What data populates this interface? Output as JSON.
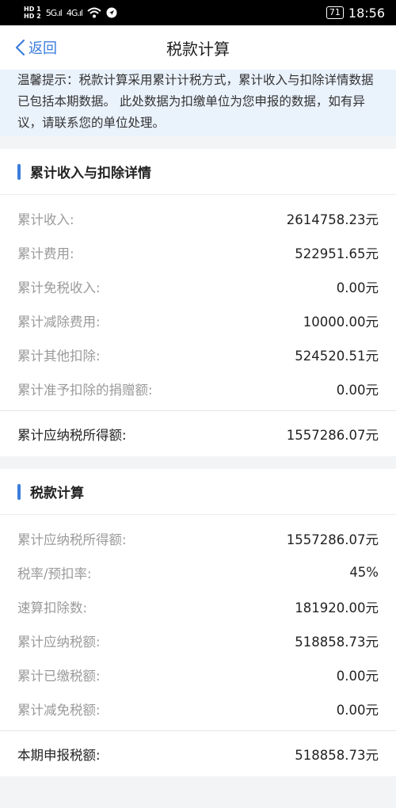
{
  "status_bar": {
    "hd1": "HD 1",
    "hd2": "HD 2",
    "signal1": "5G.ıl",
    "signal2": "4G.ıl",
    "battery": "71",
    "time": "18:56"
  },
  "nav": {
    "back_label": "返回",
    "title": "税款计算"
  },
  "notice": {
    "text": "温馨提示：税款计算采用累计计税方式，累计收入与扣除详情数据已包括本期数据。 此处数据为扣缴单位为您申报的数据，如有异议，请联系您的单位处理。"
  },
  "income_section": {
    "title": "累计收入与扣除详情",
    "rows": [
      {
        "label": "累计收入:",
        "value": "2614758.23元"
      },
      {
        "label": "累计费用:",
        "value": "522951.65元"
      },
      {
        "label": "累计免税收入:",
        "value": "0.00元"
      },
      {
        "label": "累计减除费用:",
        "value": "10000.00元"
      },
      {
        "label": "累计其他扣除:",
        "value": "524520.51元"
      },
      {
        "label": "累计准予扣除的捐赠额:",
        "value": "0.00元"
      }
    ],
    "total_label": "累计应纳税所得额:",
    "total_value": "1557286.07元"
  },
  "tax_section": {
    "title": "税款计算",
    "rows": [
      {
        "label": "累计应纳税所得额:",
        "value": "1557286.07元"
      },
      {
        "label": "税率/预扣率:",
        "value": "45%"
      },
      {
        "label": "速算扣除数:",
        "value": "181920.00元"
      },
      {
        "label": "累计应纳税额:",
        "value": "518858.73元"
      },
      {
        "label": "累计已缴税额:",
        "value": "0.00元"
      },
      {
        "label": "累计减免税额:",
        "value": "0.00元"
      }
    ],
    "total_label": "本期申报税额:",
    "total_value": "518858.73元"
  },
  "colors": {
    "accent": "#3b7ddd",
    "notice_bg": "#eaf2fc"
  }
}
